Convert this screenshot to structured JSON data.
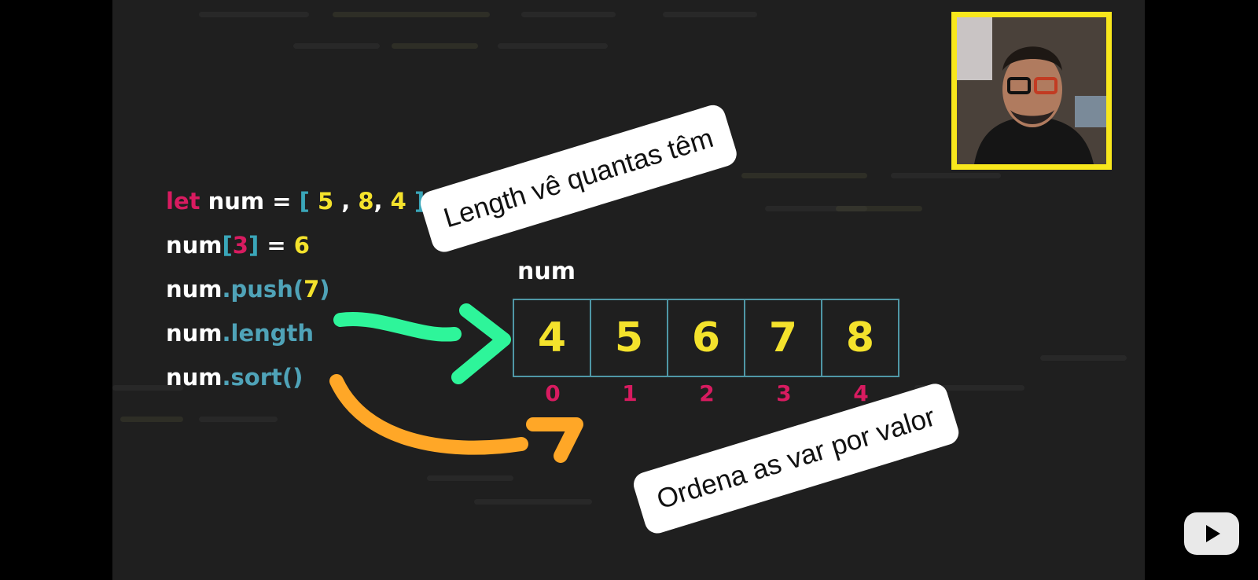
{
  "code_lines": {
    "line1": {
      "kw": "let",
      "ident": " num ",
      "eq": "= ",
      "open": "[ ",
      "v1": "5",
      "sep1": " , ",
      "v2": "8",
      "sep2": ", ",
      "v3": "4",
      "close": " ]"
    },
    "line2": {
      "ident": "num",
      "open": "[",
      "idx": "3",
      "close": "]",
      "rest": " = ",
      "val": "6"
    },
    "line3": {
      "ident": "num",
      "meth": ".push(",
      "arg": "7",
      "close": ")"
    },
    "line4": {
      "ident": "num",
      "meth": ".length"
    },
    "line5": {
      "ident": "num",
      "meth": ".sort()"
    }
  },
  "array": {
    "label": "num",
    "values": [
      "4",
      "5",
      "6",
      "7",
      "8"
    ],
    "indices": [
      "0",
      "1",
      "2",
      "3",
      "4"
    ]
  },
  "notes": {
    "length": "Length vê quantas têm",
    "sort": "Ordena as var por valor"
  },
  "colors": {
    "keyword": "#d81b60",
    "number": "#f4e22c",
    "method": "#4fa3b8",
    "arrow_green": "#2ef59a",
    "arrow_orange": "#ffa727",
    "webcam_border": "#f8e71c"
  },
  "icons": {
    "play": "play-icon"
  }
}
